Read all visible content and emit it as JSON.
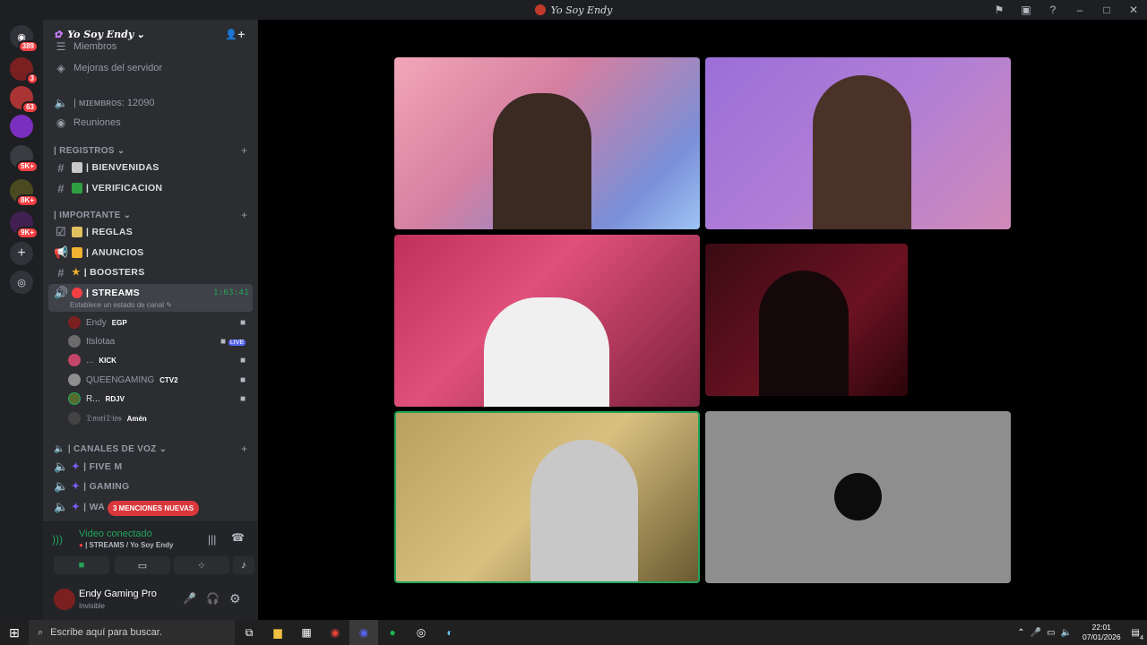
{
  "window": {
    "title": "Yo Soy Endy"
  },
  "server": {
    "name": "Yo Soy Endy"
  },
  "guild_badges": [
    "389",
    "3",
    "63",
    "5K+",
    "8K+",
    "9K+"
  ],
  "top_rows": {
    "partial": "Miembros",
    "boosts": "Mejoras del servidor",
    "members": "| ᴍɪᴇᴍʙʀᴏs: 12090",
    "meetings": "Reuniones"
  },
  "categories": {
    "registros": "| REGISTROS",
    "importante": "| IMPORTANTE",
    "voz": "| CANALES DE VOZ"
  },
  "channels": {
    "bienvenidas": "| BIENVENIDAS",
    "verificacion": "| VERIFICACION",
    "reglas": "| REGLAS",
    "anuncios": "| ANUNCIOS",
    "boosters": "| BOOSTERS",
    "streams": "| STREAMS",
    "streams_time": "1:63:41",
    "streams_status": "Establece un estado de canal",
    "fivem": "| FIVE M",
    "gaming": "| GAMING",
    "wa": "| WA"
  },
  "voice_users": [
    {
      "name": "Endy",
      "tag": "EGP"
    },
    {
      "name": "Itslotaa",
      "tag": ""
    },
    {
      "name": "...",
      "tag": "KICK"
    },
    {
      "name": "QUEENGAMING",
      "tag": "CTV2"
    },
    {
      "name": "R...",
      "tag": "RDJV"
    },
    {
      "name": "𝔇𝔬𝔪𝔦𝔇𝔦𝔬𝔰",
      "tag": "Amén"
    }
  ],
  "mentions_pill": "3 MENCIONES NUEVAS",
  "voice_panel": {
    "status": "Video conectado",
    "location": "| STREAMS / Yo Soy Endy"
  },
  "user_panel": {
    "name": "Endy Gaming Pro",
    "status": "Invisible"
  },
  "taskbar": {
    "search": "Escribe aquí para buscar.",
    "time": "22:01",
    "date": "07/01/2026",
    "notif": "4"
  },
  "colors": {
    "accent_green": "#23a55a",
    "mention_red": "#f23f43",
    "sidebar": "#2b2d31"
  },
  "icons": [
    "discord-icon",
    "add-server-icon",
    "explore-icon",
    "invite-icon",
    "hash-icon",
    "speaker-icon",
    "camera-icon",
    "mic-icon",
    "headphones-icon",
    "gear-icon",
    "phone-hangup-icon",
    "windows-icon",
    "search-icon"
  ]
}
